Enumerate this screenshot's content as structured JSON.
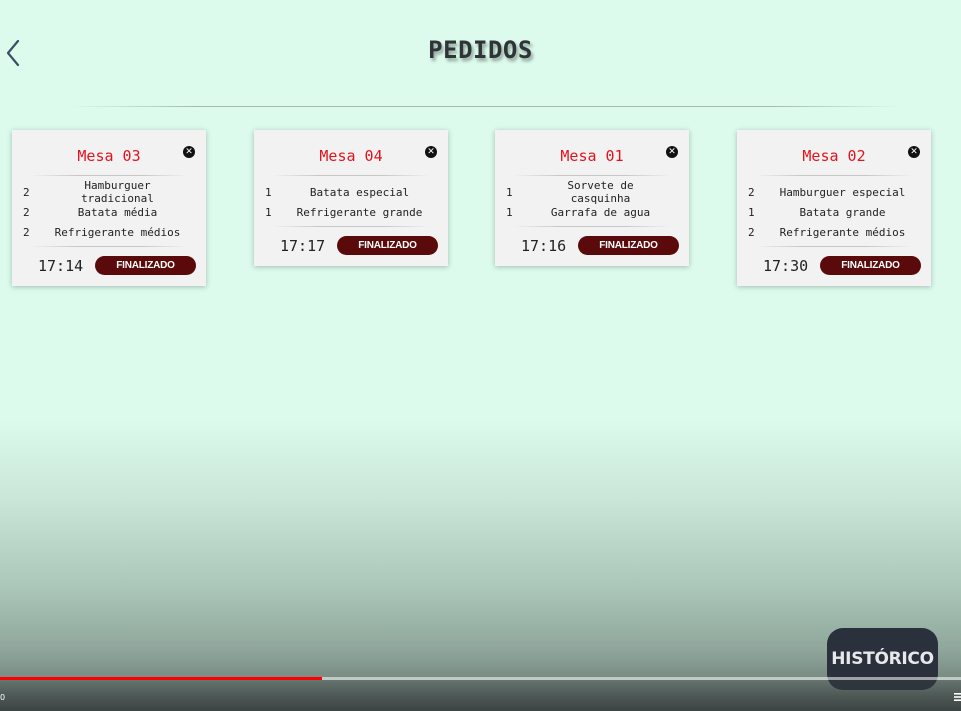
{
  "header": {
    "back_icon": "chevron-left-icon",
    "title": "PEDIDOS"
  },
  "orders": [
    {
      "table": "Mesa 03",
      "items": [
        {
          "qty": "2",
          "name": "Hamburguer tradicional"
        },
        {
          "qty": "2",
          "name": "Batata média"
        },
        {
          "qty": "2",
          "name": "Refrigerante médios"
        }
      ],
      "time": "17:14",
      "status": "FINALIZADO"
    },
    {
      "table": "Mesa 04",
      "items": [
        {
          "qty": "1",
          "name": "Batata especial"
        },
        {
          "qty": "1",
          "name": "Refrigerante grande"
        }
      ],
      "time": "17:17",
      "status": "FINALIZADO"
    },
    {
      "table": "Mesa 01",
      "items": [
        {
          "qty": "1",
          "name": "Sorvete de casquinha"
        },
        {
          "qty": "1",
          "name": "Garrafa de agua"
        }
      ],
      "time": "17:16",
      "status": "FINALIZADO"
    },
    {
      "table": "Mesa 02",
      "items": [
        {
          "qty": "2",
          "name": "Hamburguer especial"
        },
        {
          "qty": "1",
          "name": "Batata grande"
        },
        {
          "qty": "2",
          "name": "Refrigerante médios"
        }
      ],
      "time": "17:30",
      "status": "FINALIZADO"
    }
  ],
  "close_icon": "close-circle-icon",
  "history_button": "HISTÓRICO",
  "video_player": {
    "progress": 0.335,
    "time_label": "0"
  },
  "colors": {
    "background": "#dcfbec",
    "table_title": "#e0141d",
    "status_button": "#5a0a0a",
    "history_button": "#2a313c",
    "progress": "#ff0000"
  }
}
